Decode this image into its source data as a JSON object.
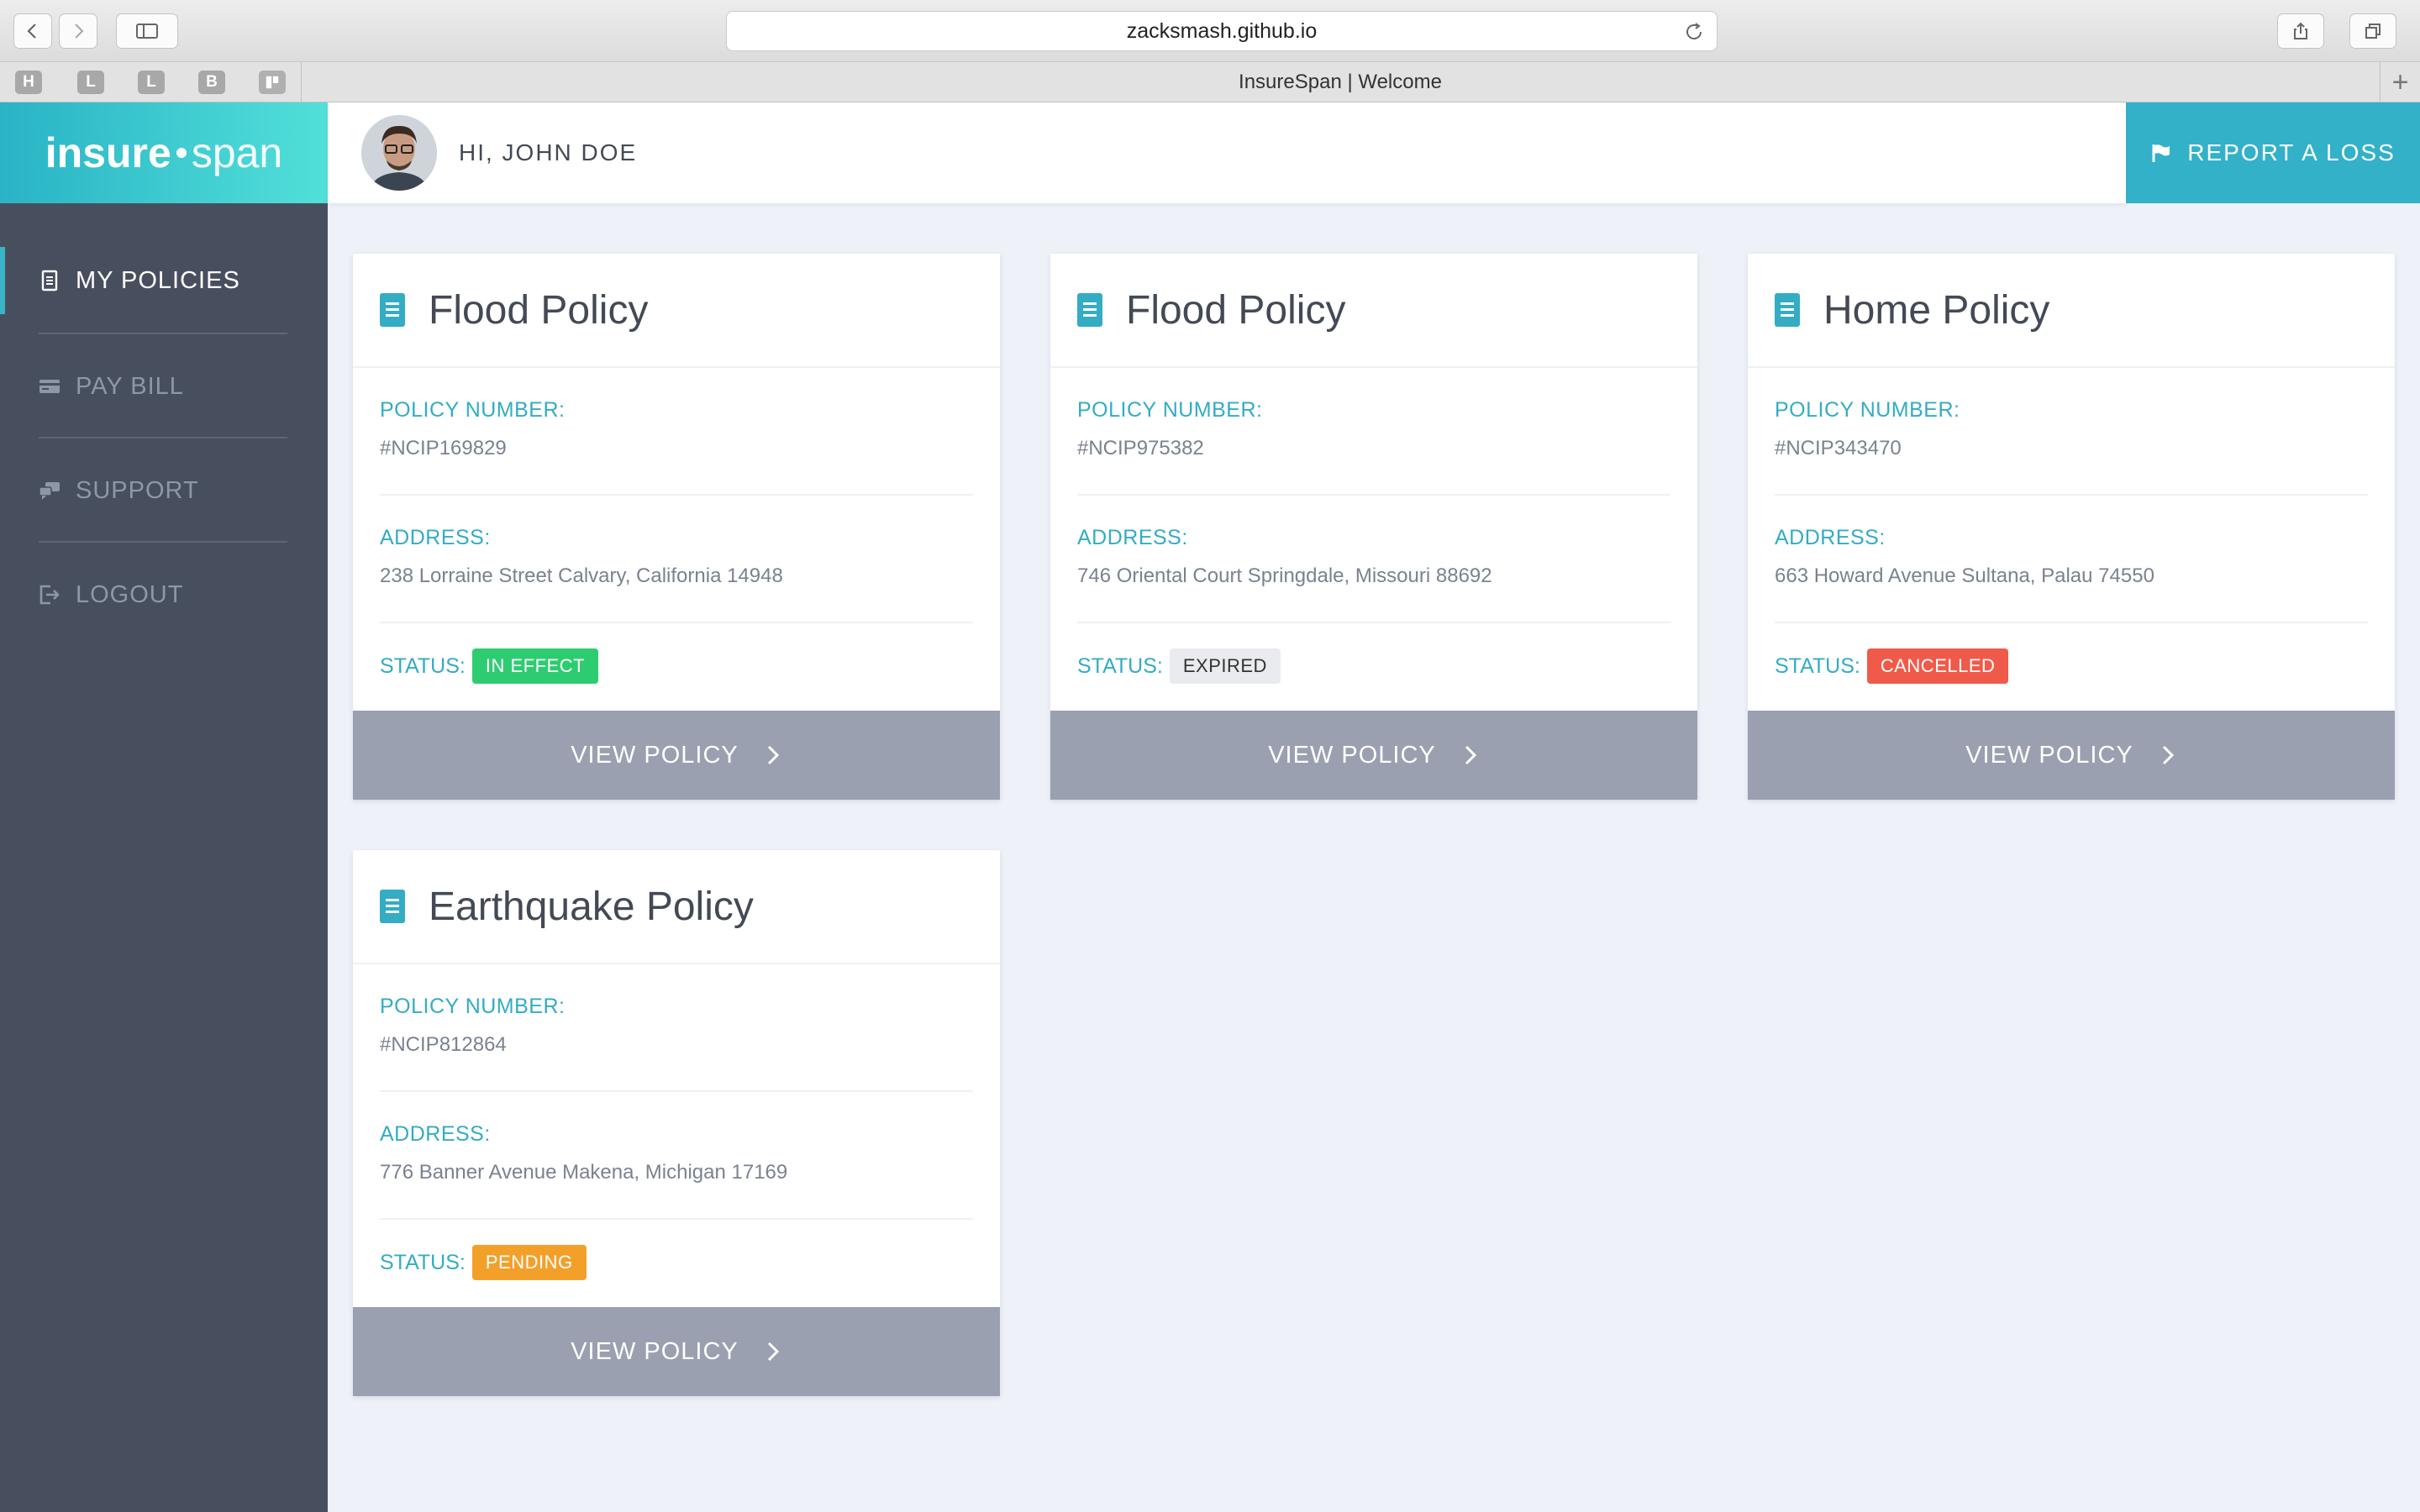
{
  "browser": {
    "url": "zacksmash.github.io",
    "tab_title": "InsureSpan | Welcome",
    "bookmarks": [
      "H",
      "L",
      "L",
      "B"
    ]
  },
  "header": {
    "logo_bold": "insure",
    "logo_light": "span",
    "greeting": "HI, JOHN DOE",
    "report_label": "REPORT A LOSS"
  },
  "sidebar": {
    "items": [
      {
        "label": "MY POLICIES",
        "icon": "document-icon"
      },
      {
        "label": "PAY BILL",
        "icon": "credit-card-icon"
      },
      {
        "label": "SUPPORT",
        "icon": "chat-bubbles-icon"
      },
      {
        "label": "LOGOUT",
        "icon": "logout-icon"
      }
    ]
  },
  "labels": {
    "policy_number": "POLICY NUMBER:",
    "address": "ADDRESS:",
    "status": "STATUS:",
    "view": "VIEW POLICY"
  },
  "colors": {
    "accent": "#33b1c9",
    "sidebar": "#474f5f",
    "in_effect": "#2ecc71",
    "expired": "#e9ebee",
    "cancelled": "#f05a4a",
    "pending": "#f3a02a"
  },
  "policies": [
    {
      "title": "Flood Policy",
      "number": "#NCIP169829",
      "address": "238 Lorraine Street Calvary, California 14948",
      "status": "IN EFFECT",
      "status_color": "#2ecc71",
      "status_text_color": "#ffffff"
    },
    {
      "title": "Flood Policy",
      "number": "#NCIP975382",
      "address": "746 Oriental Court Springdale, Missouri 88692",
      "status": "EXPIRED",
      "status_color": "#e9ebee",
      "status_text_color": "#333333"
    },
    {
      "title": "Home Policy",
      "number": "#NCIP343470",
      "address": "663 Howard Avenue Sultana, Palau 74550",
      "status": "CANCELLED",
      "status_color": "#f05a4a",
      "status_text_color": "#ffffff"
    },
    {
      "title": "Earthquake Policy",
      "number": "#NCIP812864",
      "address": "776 Banner Avenue Makena, Michigan 17169",
      "status": "PENDING",
      "status_color": "#f3a02a",
      "status_text_color": "#ffffff"
    }
  ]
}
